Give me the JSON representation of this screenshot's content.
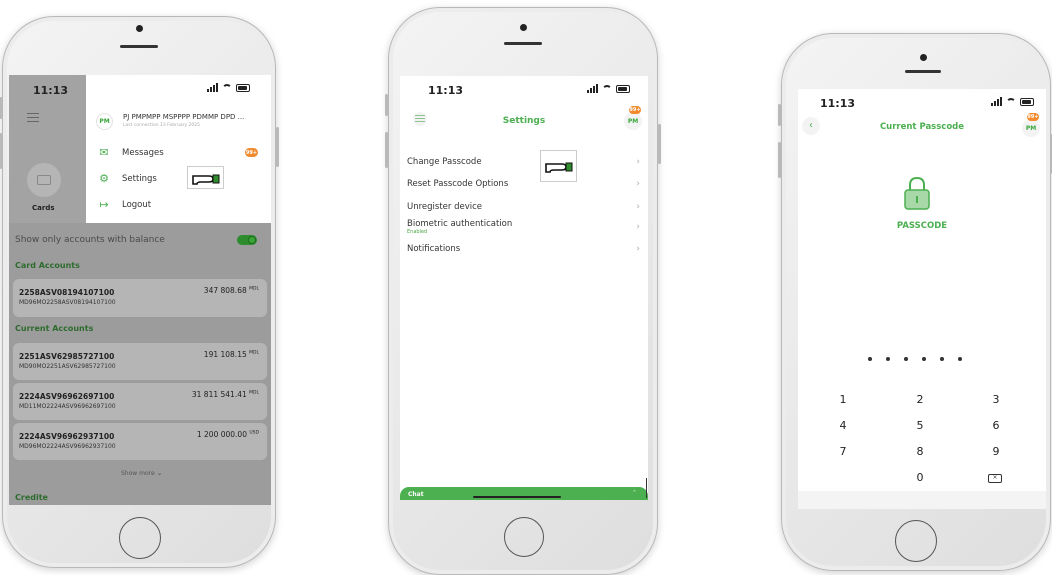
{
  "phone1": {
    "status_time": "11:13",
    "menu": {
      "avatar_initials": "PM",
      "user_name": "PJ PMPMPP MSPPPP PDMMP DPD ...",
      "last_connection": "Last connection 13 February 2025",
      "items": [
        {
          "label": "Messages",
          "icon": "envelope-icon"
        },
        {
          "label": "Settings",
          "icon": "gear-icon"
        },
        {
          "label": "Logout",
          "icon": "logout-icon"
        }
      ],
      "messages_badge": "99+"
    },
    "cards_label": "Cards",
    "balance_toggle_label": "Show only accounts with balance",
    "card_accounts_title": "Card Accounts",
    "current_accounts_title": "Current Accounts",
    "card_accounts": [
      {
        "number": "2258ASV08194107100",
        "iban": "MD96MO2258ASV08194107100",
        "balance": "347 808.68",
        "currency": "MDL"
      }
    ],
    "current_accounts": [
      {
        "number": "2251ASV62985727100",
        "iban": "MD90MO2251ASV62985727100",
        "balance": "191 108.15",
        "currency": "MDL"
      },
      {
        "number": "2224ASV96962697100",
        "iban": "MD11MO2224ASV96962697100",
        "balance": "31 811 541.41",
        "currency": "MDL"
      },
      {
        "number": "2224ASV96962937100",
        "iban": "MD96MO2224ASV96962937100",
        "balance": "1 200 000.00",
        "currency": "USD"
      }
    ],
    "show_more": "Show more",
    "credits_title": "Credite"
  },
  "phone2": {
    "status_time": "11:13",
    "title": "Settings",
    "avatar_initials": "PM",
    "badge": "99+",
    "items": [
      {
        "label": "Change Passcode",
        "sub": ""
      },
      {
        "label": "Reset Passcode Options",
        "sub": ""
      },
      {
        "label": "Unregister device",
        "sub": ""
      },
      {
        "label": "Biometric authentication",
        "sub": "Enabled"
      },
      {
        "label": "Notifications",
        "sub": ""
      }
    ],
    "chat_label": "Chat"
  },
  "phone3": {
    "status_time": "11:13",
    "title": "Current Passcode",
    "avatar_initials": "PM",
    "badge": "99+",
    "passcode_label": "PASSCODE",
    "keys": [
      "1",
      "2",
      "3",
      "4",
      "5",
      "6",
      "7",
      "8",
      "9",
      "0"
    ]
  },
  "colors": {
    "accent": "#4caf50",
    "badge": "#f28a2e",
    "overlay": "#9c9c9c"
  }
}
